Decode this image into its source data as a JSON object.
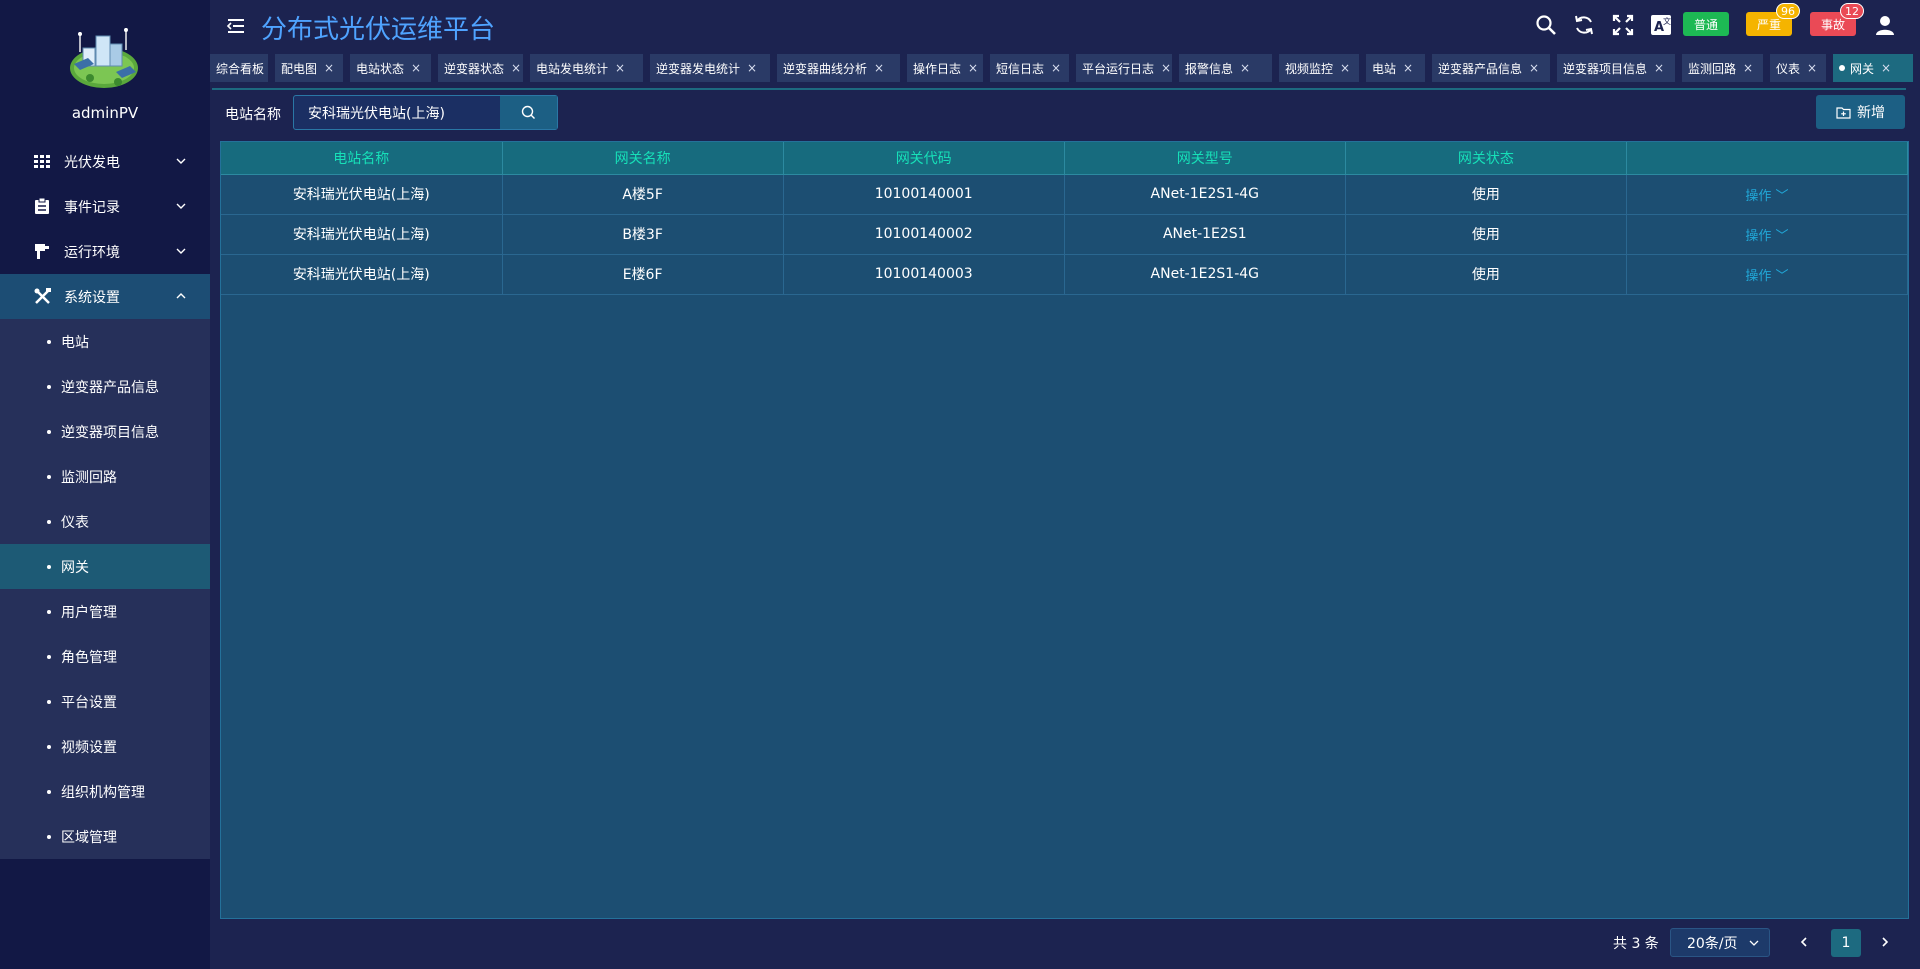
{
  "app": {
    "title": "分布式光伏运维平台",
    "username": "adminPV"
  },
  "header": {
    "alarms": [
      {
        "label": "普通",
        "color": "#1db954",
        "count": ""
      },
      {
        "label": "严重",
        "color": "#f5b400",
        "count": "96"
      },
      {
        "label": "事故",
        "color": "#ea4a56",
        "count": "12"
      }
    ]
  },
  "sidebar": {
    "menus": [
      {
        "label": "光伏发电",
        "icon": "grid-icon"
      },
      {
        "label": "事件记录",
        "icon": "clipboard-icon"
      },
      {
        "label": "运行环境",
        "icon": "plug-icon"
      },
      {
        "label": "系统设置",
        "icon": "tools-icon"
      }
    ],
    "sub_items": [
      "电站",
      "逆变器产品信息",
      "逆变器项目信息",
      "监测回路",
      "仪表",
      "网关",
      "用户管理",
      "角色管理",
      "平台设置",
      "视频设置",
      "组织机构管理",
      "区域管理"
    ],
    "active_sub": "网关"
  },
  "tabs": [
    "综合看板",
    "配电图",
    "电站状态",
    "逆变器状态",
    "电站发电统计",
    "逆变器发电统计",
    "逆变器曲线分析",
    "操作日志",
    "短信日志",
    "平台运行日志",
    "报警信息",
    "视频监控",
    "电站",
    "逆变器产品信息",
    "逆变器项目信息",
    "监测回路",
    "仪表",
    "网关"
  ],
  "tab_close": "×",
  "search": {
    "label": "电站名称",
    "value": "安科瑞光伏电站(上海)"
  },
  "add_button": "新增",
  "table": {
    "columns": [
      "电站名称",
      "网关名称",
      "网关代码",
      "网关型号",
      "网关状态",
      ""
    ],
    "rows": [
      [
        "安科瑞光伏电站(上海)",
        "A楼5F",
        "10100140001",
        "ANet-1E2S1-4G",
        "使用",
        "操作"
      ],
      [
        "安科瑞光伏电站(上海)",
        "B楼3F",
        "10100140002",
        "ANet-1E2S1",
        "使用",
        "操作"
      ],
      [
        "安科瑞光伏电站(上海)",
        "E楼6F",
        "10100140003",
        "ANet-1E2S1-4G",
        "使用",
        "操作"
      ]
    ]
  },
  "pager": {
    "total": "共 3 条",
    "size": "20条/页",
    "page": "1"
  }
}
